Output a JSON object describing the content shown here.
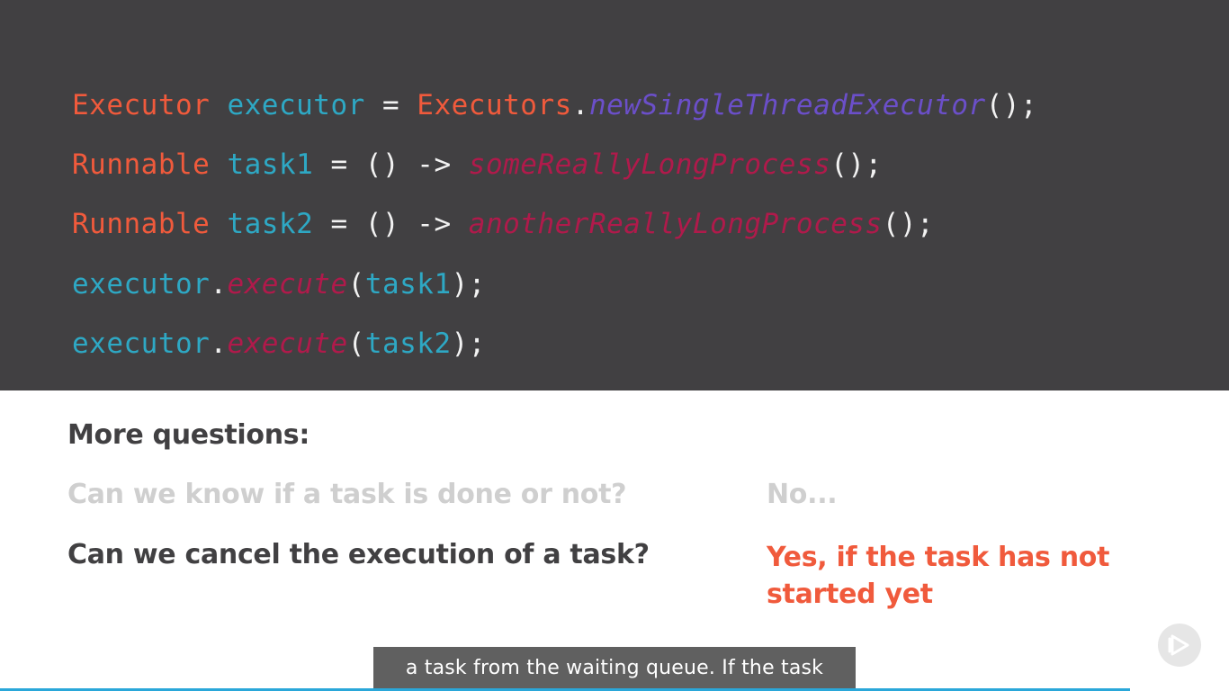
{
  "code": {
    "line1": {
      "type": "Executor",
      "var": "executor",
      "eq": " = ",
      "cls": "Executors",
      "dot": ".",
      "method": "newSingleThreadExecutor",
      "tail": "();"
    },
    "line2": {
      "type": "Runnable",
      "var": "task1",
      "mid": " = () -> ",
      "method": "someReallyLongProcess",
      "tail": "();"
    },
    "line3": {
      "type": "Runnable",
      "var": "task2",
      "mid": " = () -> ",
      "method": "anotherReallyLongProcess",
      "tail": "();"
    },
    "line4": {
      "obj": "executor",
      "dot": ".",
      "method": "execute",
      "open": "(",
      "arg": "task1",
      "close": ");"
    },
    "line5": {
      "obj": "executor",
      "dot": ".",
      "method": "execute",
      "open": "(",
      "arg": "task2",
      "close": ");"
    }
  },
  "qa": {
    "heading": "More questions:",
    "items": [
      {
        "question": "Can we know if a task is done or not?",
        "answer": "No..."
      },
      {
        "question": "Can we cancel the execution of a task?",
        "answer": "Yes, if the task has not started yet"
      }
    ]
  },
  "caption": "a task from the waiting queue. If the task",
  "icons": {
    "player_badge": "play-icon"
  },
  "colors": {
    "code_bg": "#414042",
    "keyword_type": "#f05a3c",
    "identifier": "#2ea8c4",
    "static_method": "#6b4fc9",
    "method": "#b01a4b",
    "answer_accent": "#f05a3c",
    "progress": "#2aa7d9"
  }
}
